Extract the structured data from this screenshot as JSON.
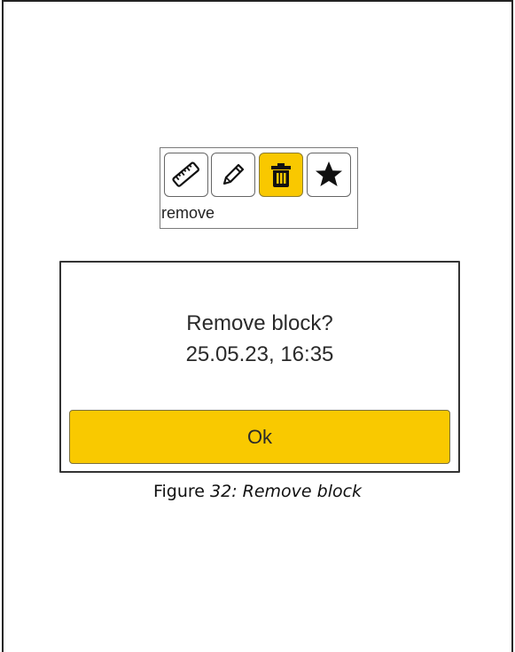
{
  "toolbar": {
    "label": "remove",
    "buttons": [
      {
        "icon": "ruler-icon",
        "active": false
      },
      {
        "icon": "pencil-icon",
        "active": false
      },
      {
        "icon": "trash-icon",
        "active": true
      },
      {
        "icon": "star-icon",
        "active": false
      }
    ],
    "accent_color": "#f9c800"
  },
  "dialog": {
    "title": "Remove block?",
    "timestamp": "25.05.23, 16:35",
    "ok_label": "Ok"
  },
  "caption": {
    "prefix": "Figure ",
    "number_title": "32: Remove block"
  }
}
